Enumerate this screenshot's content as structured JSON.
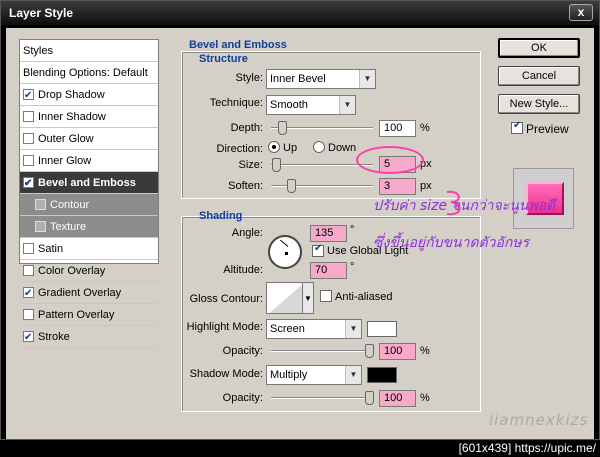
{
  "window": {
    "title": "Layer Style",
    "close_label": "x"
  },
  "style_list": {
    "header": "Styles",
    "blending": "Blending Options: Default",
    "items": [
      {
        "label": "Drop Shadow",
        "checked": true
      },
      {
        "label": "Inner Shadow",
        "checked": false
      },
      {
        "label": "Outer Glow",
        "checked": false
      },
      {
        "label": "Inner Glow",
        "checked": false
      },
      {
        "label": "Bevel and Emboss",
        "checked": true
      },
      {
        "label": "Contour",
        "checked": false
      },
      {
        "label": "Texture",
        "checked": false
      },
      {
        "label": "Satin",
        "checked": false
      },
      {
        "label": "Color Overlay",
        "checked": false
      },
      {
        "label": "Gradient Overlay",
        "checked": true
      },
      {
        "label": "Pattern Overlay",
        "checked": false
      },
      {
        "label": "Stroke",
        "checked": true
      }
    ]
  },
  "bevel": {
    "title": "Bevel and Emboss",
    "structure_title": "Structure",
    "style_label": "Style:",
    "style_value": "Inner Bevel",
    "technique_label": "Technique:",
    "technique_value": "Smooth",
    "depth_label": "Depth:",
    "depth_value": "100",
    "depth_unit": "%",
    "direction_label": "Direction:",
    "direction_up": "Up",
    "direction_down": "Down",
    "direction_selected": "Up",
    "size_label": "Size:",
    "size_value": "5",
    "size_unit": "px",
    "soften_label": "Soften:",
    "soften_value": "3",
    "soften_unit": "px"
  },
  "shading": {
    "title": "Shading",
    "angle_label": "Angle:",
    "angle_value": "135",
    "angle_unit": "°",
    "global_light_label": "Use Global Light",
    "global_light_checked": true,
    "altitude_label": "Altitude:",
    "altitude_value": "70",
    "altitude_unit": "°",
    "gloss_contour_label": "Gloss Contour:",
    "anti_aliased_label": "Anti-aliased",
    "anti_aliased_checked": false,
    "highlight_mode_label": "Highlight Mode:",
    "highlight_mode_value": "Screen",
    "highlight_color": "#ffffff",
    "highlight_opacity_label": "Opacity:",
    "highlight_opacity_value": "100",
    "highlight_opacity_unit": "%",
    "shadow_mode_label": "Shadow Mode:",
    "shadow_mode_value": "Multiply",
    "shadow_color": "#000000",
    "shadow_opacity_label": "Opacity:",
    "shadow_opacity_value": "100",
    "shadow_opacity_unit": "%"
  },
  "buttons": {
    "ok": "OK",
    "cancel": "Cancel",
    "new_style": "New Style...",
    "preview_label": "Preview",
    "preview_checked": true
  },
  "annotation": {
    "line1": "ปรับค่า size จนกว่าจะนูนพอดี",
    "line2": "ซึ่งขึ้นอยู่กับขนาดตัวอักษร"
  },
  "watermark": "iiamnexkizs",
  "footer": "[601x439] https://upic.me/"
}
